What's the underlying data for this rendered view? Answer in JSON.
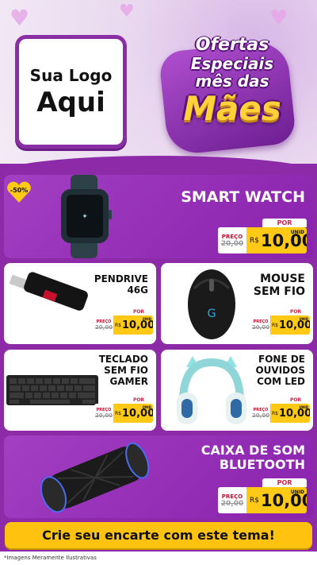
{
  "header": {
    "logo_line1": "Sua Logo",
    "logo_line2": "Aqui",
    "title_line1": "Ofertas",
    "title_line2": "Especiais",
    "title_line3": "mês das",
    "title_line4": "Mães"
  },
  "badge": {
    "label": "-50%",
    "icon": "heart-icon"
  },
  "products": [
    {
      "name": "SMART WATCH",
      "por": "POR",
      "preco": "PREÇO",
      "de": "DE",
      "old": "20,00",
      "currency": "R$",
      "value": "10,00",
      "unit": "UNID",
      "image": "smart-watch-image"
    },
    {
      "name_lines": [
        "PENDRIVE",
        "4 6 G"
      ],
      "name": "PENDRIVE\n46G",
      "por": "POR",
      "preco": "PREÇO",
      "de": "DE",
      "old": "20,00",
      "currency": "R$",
      "value": "10,00",
      "unit": "UNID",
      "image": "usb-drive-image"
    },
    {
      "name_lines": [
        "MOUSE",
        "SEM FIO"
      ],
      "por": "POR",
      "preco": "PREÇO",
      "de": "DE",
      "old": "20,00",
      "currency": "R$",
      "value": "10,00",
      "unit": "UNID",
      "image": "gaming-mouse-image"
    },
    {
      "name_lines": [
        "TECLADO",
        "SEM FIO",
        "GAMER"
      ],
      "por": "POR",
      "preco": "PREÇO",
      "de": "DE",
      "old": "20,00",
      "currency": "R$",
      "value": "10,00",
      "unit": "UNID",
      "image": "keyboard-image"
    },
    {
      "name_lines": [
        "FONE DE",
        "OUVIDOS",
        "COM LED"
      ],
      "por": "POR",
      "preco": "PREÇO",
      "de": "DE",
      "old": "20,00",
      "currency": "R$",
      "value": "10,00",
      "unit": "UNID",
      "image": "headphones-image"
    },
    {
      "name_lines": [
        "CAIXA DE SOM",
        "BLUETOOTH"
      ],
      "por": "POR",
      "preco": "PREÇO",
      "de": "DE",
      "old": "20,00",
      "currency": "R$",
      "value": "10,00",
      "unit": "UNID",
      "image": "speaker-image"
    }
  ],
  "cta": "Crie seu encarte com este tema!",
  "footer": "*Imagens Meramente Ilustrativas",
  "colors": {
    "purple": "#8c2aa8",
    "yellow": "#ffc915",
    "red": "#c8102e"
  }
}
